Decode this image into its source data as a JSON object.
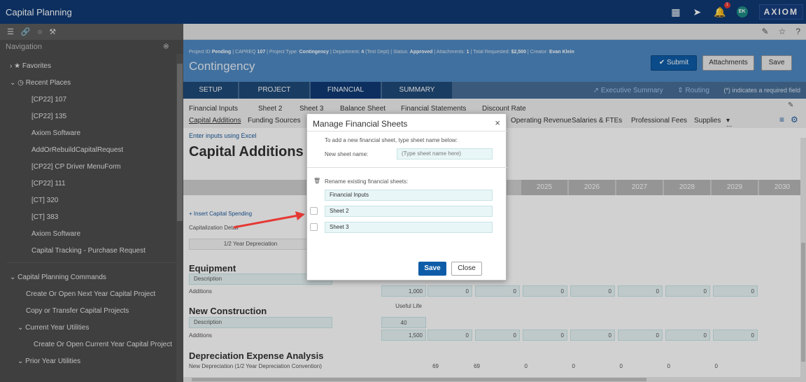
{
  "app": {
    "title": "Capital Planning",
    "brand": "AXIOM",
    "user_initials": "EK",
    "notification_count": "1"
  },
  "toolbar": {
    "icons": [
      "menu-icon",
      "link-icon",
      "chat-icon",
      "wrench-icon"
    ],
    "right_icons": [
      "edit-icon",
      "star-icon",
      "help-icon"
    ],
    "help": "?"
  },
  "nav": {
    "header": "Navigation",
    "favorites": "Favorites",
    "recent_places": "Recent Places",
    "recent": [
      "[CP22] 107",
      "[CP22] 135",
      "Axiom Software",
      "AddOrRebuildCapitalRequest",
      "[CP22] CP Driver MenuForm",
      "[CP22] 111",
      "[CT] 320",
      "[CT] 383",
      "Axiom Software",
      "Capital Tracking - Purchase Request"
    ],
    "commands_header": "Capital Planning Commands",
    "commands": [
      "Create Or Open Next Year Capital Project",
      "Copy or Transfer Capital Projects"
    ],
    "current_year": "Current Year Utilities",
    "current_year_items": [
      "Create Or Open Current Year Capital Project"
    ],
    "prior_year": "Prior Year Utilities"
  },
  "project": {
    "meta_labels": {
      "id": "Project ID",
      "type": "Project Type",
      "dept": "Department",
      "status": "Status",
      "attach": "Attachments",
      "total": "Total Requested",
      "creator": "Creator"
    },
    "id_status": "Pending",
    "id_code": "CAPREQ",
    "id_num": "107",
    "type": "Contingency",
    "dept_num": "4",
    "dept_name": "(Test Dept)",
    "status": "Approved",
    "attachments": "1",
    "total": "$2,500",
    "creator": "Evan Klein",
    "title": "Contingency",
    "submit": "Submit",
    "attachments_btn": "Attachments",
    "save": "Save"
  },
  "tabs": [
    "SETUP",
    "PROJECT",
    "FINANCIAL",
    "SUMMARY"
  ],
  "tab_links": {
    "exec": "Executive Summary",
    "routing": "Routing",
    "required": "(*) indicates a required field"
  },
  "sheet_tabs": [
    "Financial Inputs",
    "Sheet 2",
    "Sheet 3",
    "Balance Sheet",
    "Financial Statements",
    "Discount Rate"
  ],
  "sub_tabs": [
    "Capital Additions",
    "Funding Sources",
    "Operating Revenue",
    "Salaries & FTEs",
    "Professional Fees",
    "Supplies",
    "..."
  ],
  "content": {
    "excel_link": "Enter inputs using Excel",
    "heading": "Capital Additions",
    "years": [
      "2025",
      "2026",
      "2027",
      "2028",
      "2029",
      "2030"
    ],
    "insert": "Insert Capital Spending",
    "cap_detail": "Capitalization Detail",
    "depreciation": "1/2 Year Depreciation",
    "equipment": "Equipment",
    "description": "Description",
    "additions": "Additions",
    "eq_additions": [
      "1,000",
      "0",
      "0",
      "0",
      "0",
      "0",
      "0",
      "0"
    ],
    "new_construction": "New Construction",
    "useful_life": "Useful Life",
    "nc_useful_life": "40",
    "nc_additions": [
      "1,500",
      "0",
      "0",
      "0",
      "0",
      "0",
      "0",
      "0"
    ],
    "dep_heading": "Depreciation Expense Analysis",
    "new_dep": "New Depreciation (1/2 Year Depreciation Convention)",
    "dep_values": [
      "69",
      "69",
      "0",
      "0",
      "0",
      "0",
      "0"
    ]
  },
  "modal": {
    "title": "Manage Financial Sheets",
    "close_x": "×",
    "add_hint": "To add a new financial sheet, type sheet name below:",
    "new_label": "New sheet name:",
    "new_placeholder": "(Type sheet name here)",
    "rename_label": "Rename existing financial sheets:",
    "sheets": [
      "Financial Inputs",
      "Sheet 2",
      "Sheet 3"
    ],
    "save": "Save",
    "close": "Close"
  }
}
